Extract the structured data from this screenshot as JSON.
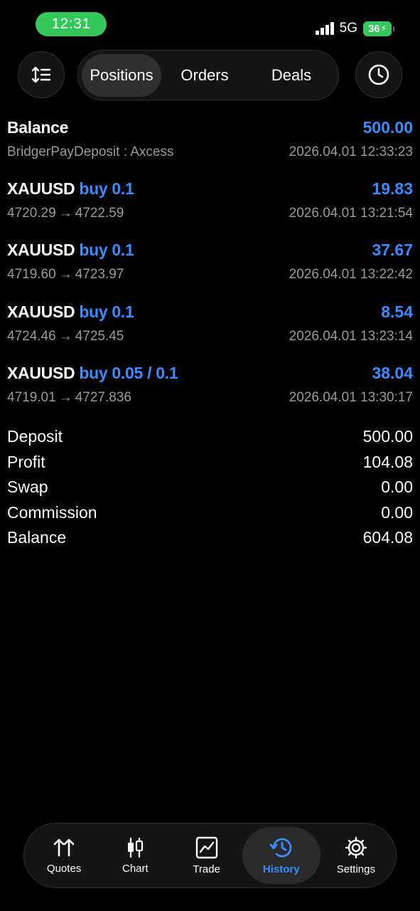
{
  "status": {
    "time": "12:31",
    "network": "5G",
    "battery": "36"
  },
  "top": {
    "sort_icon": "sort-icon",
    "tabs": [
      {
        "label": "Positions",
        "active": true
      },
      {
        "label": "Orders",
        "active": false
      },
      {
        "label": "Deals",
        "active": false
      }
    ],
    "clock_icon": "clock-icon"
  },
  "balance_row": {
    "title": "Balance",
    "value": "500.00",
    "subtitle": "BridgerPayDeposit : Axcess",
    "datetime": "2026.04.01 12:33:23"
  },
  "positions": [
    {
      "symbol": "XAUUSD",
      "side": "buy 0.1",
      "profit": "19.83",
      "open": "4720.29",
      "close": "4722.59",
      "datetime": "2026.04.01 13:21:54"
    },
    {
      "symbol": "XAUUSD",
      "side": "buy 0.1",
      "profit": "37.67",
      "open": "4719.60",
      "close": "4723.97",
      "datetime": "2026.04.01 13:22:42"
    },
    {
      "symbol": "XAUUSD",
      "side": "buy 0.1",
      "profit": "8.54",
      "open": "4724.46",
      "close": "4725.45",
      "datetime": "2026.04.01 13:23:14"
    },
    {
      "symbol": "XAUUSD",
      "side": "buy 0.05 / 0.1",
      "profit": "38.04",
      "open": "4719.01",
      "close": "4727.836",
      "datetime": "2026.04.01 13:30:17"
    }
  ],
  "arrow": "→",
  "summary": [
    {
      "label": "Deposit",
      "value": "500.00"
    },
    {
      "label": "Profit",
      "value": "104.08"
    },
    {
      "label": "Swap",
      "value": "0.00"
    },
    {
      "label": "Commission",
      "value": "0.00"
    },
    {
      "label": "Balance",
      "value": "604.08"
    }
  ],
  "tabbar": [
    {
      "label": "Quotes",
      "icon": "quotes-icon",
      "active": false
    },
    {
      "label": "Chart",
      "icon": "candlestick-icon",
      "active": false
    },
    {
      "label": "Trade",
      "icon": "trade-chart-icon",
      "active": false
    },
    {
      "label": "History",
      "icon": "history-icon",
      "active": true
    },
    {
      "label": "Settings",
      "icon": "gear-icon",
      "active": false
    }
  ],
  "colors": {
    "accent": "#3a8cff",
    "status_green": "#34c759",
    "background": "#000000",
    "muted_text": "#9a9a9a"
  }
}
